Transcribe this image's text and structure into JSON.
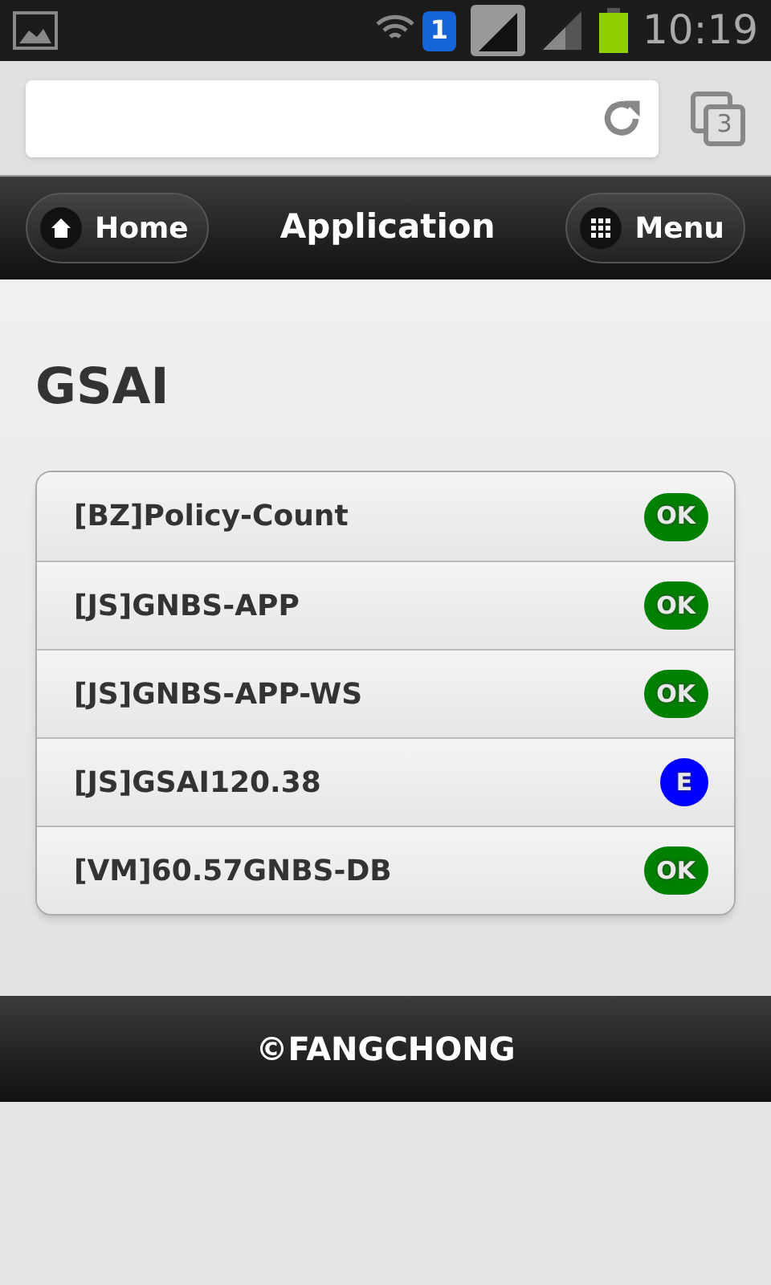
{
  "status_bar": {
    "sim": "1",
    "time": "10:19"
  },
  "browser": {
    "tab_count": "3"
  },
  "header": {
    "left_button": "Home",
    "title": "Application",
    "right_button": "Menu"
  },
  "page": {
    "heading": "GSAI"
  },
  "items": [
    {
      "label": "[BZ]Policy-Count",
      "badge": "OK",
      "color": "#008000"
    },
    {
      "label": "[JS]GNBS-APP",
      "badge": "OK",
      "color": "#008000"
    },
    {
      "label": "[JS]GNBS-APP-WS",
      "badge": "OK",
      "color": "#008000"
    },
    {
      "label": "[JS]GSAI120.38",
      "badge": "E",
      "color": "#0000ff"
    },
    {
      "label": "[VM]60.57GNBS-DB",
      "badge": "OK",
      "color": "#008000"
    }
  ],
  "footer": {
    "text": "©FANGCHONG"
  }
}
